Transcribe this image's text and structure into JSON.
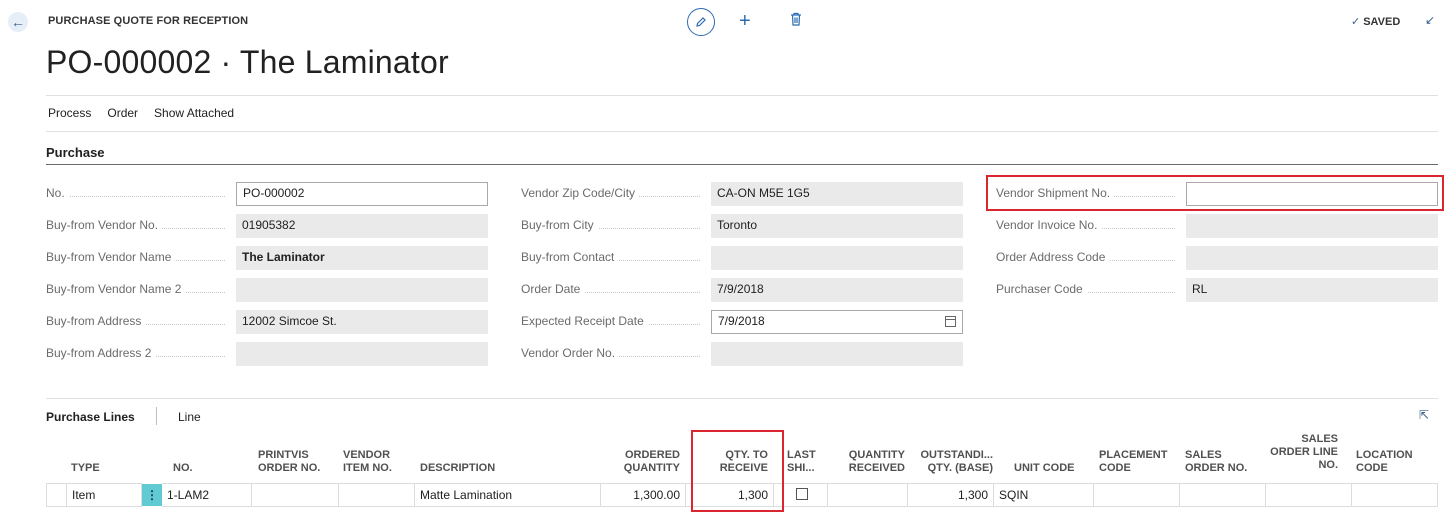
{
  "header": {
    "caption": "PURCHASE QUOTE FOR RECEPTION",
    "title": "PO-000002 · The Laminator",
    "saved_label": "SAVED"
  },
  "actions": [
    "Process",
    "Order",
    "Show Attached"
  ],
  "section": {
    "title": "Purchase"
  },
  "fields": {
    "no": {
      "label": "No.",
      "value": "PO-000002"
    },
    "vendor_no": {
      "label": "Buy-from Vendor No.",
      "value": "01905382"
    },
    "vendor_name": {
      "label": "Buy-from Vendor Name",
      "value": "The Laminator"
    },
    "vendor_name2": {
      "label": "Buy-from Vendor Name 2",
      "value": ""
    },
    "address": {
      "label": "Buy-from Address",
      "value": "12002 Simcoe St."
    },
    "address2": {
      "label": "Buy-from Address 2",
      "value": ""
    },
    "zip_city": {
      "label": "Vendor Zip Code/City",
      "value": "CA-ON M5E 1G5"
    },
    "city": {
      "label": "Buy-from City",
      "value": "Toronto"
    },
    "contact": {
      "label": "Buy-from Contact",
      "value": ""
    },
    "order_date": {
      "label": "Order Date",
      "value": "7/9/2018"
    },
    "receipt_date": {
      "label": "Expected Receipt Date",
      "value": "7/9/2018"
    },
    "vendor_order_no": {
      "label": "Vendor Order No.",
      "value": ""
    },
    "shipment_no": {
      "label": "Vendor Shipment No.",
      "value": ""
    },
    "invoice_no": {
      "label": "Vendor Invoice No.",
      "value": ""
    },
    "order_address": {
      "label": "Order Address Code",
      "value": ""
    },
    "purchaser": {
      "label": "Purchaser Code",
      "value": "RL"
    }
  },
  "lines": {
    "title": "Purchase Lines",
    "tab": "Line",
    "columns": {
      "type": "TYPE",
      "no": "NO.",
      "printvis1": "PRINTVIS",
      "printvis2": "ORDER NO.",
      "vendor_item1": "VENDOR",
      "vendor_item2": "ITEM NO.",
      "description": "DESCRIPTION",
      "ordered1": "ORDERED",
      "ordered2": "QUANTITY",
      "qty_recv1": "QTY. TO",
      "qty_recv2": "RECEIVE",
      "last1": "LAST",
      "last2": "SHI...",
      "qty_received1": "QUANTITY",
      "qty_received2": "RECEIVED",
      "outstanding1": "OUTSTANDI...",
      "outstanding2": "QTY. (BASE)",
      "unit_code": "UNIT CODE",
      "placement1": "PLACEMENT",
      "placement2": "CODE",
      "sales_order1": "SALES",
      "sales_order2": "ORDER NO.",
      "sales_line1": "SALES",
      "sales_line2": "ORDER LINE",
      "sales_line3": "NO.",
      "location1": "LOCATION",
      "location2": "CODE"
    },
    "rows": [
      {
        "type": "Item",
        "no": "1-LAM2",
        "description": "Matte Lamination",
        "ordered_quantity": "1,300.00",
        "qty_to_receive": "1,300",
        "outstanding": "1,300",
        "unit_code": "SQIN"
      }
    ]
  },
  "colors": {
    "accent": "#2b6cb0",
    "highlight": "#d9262f",
    "row_button": "#61cbd4"
  }
}
